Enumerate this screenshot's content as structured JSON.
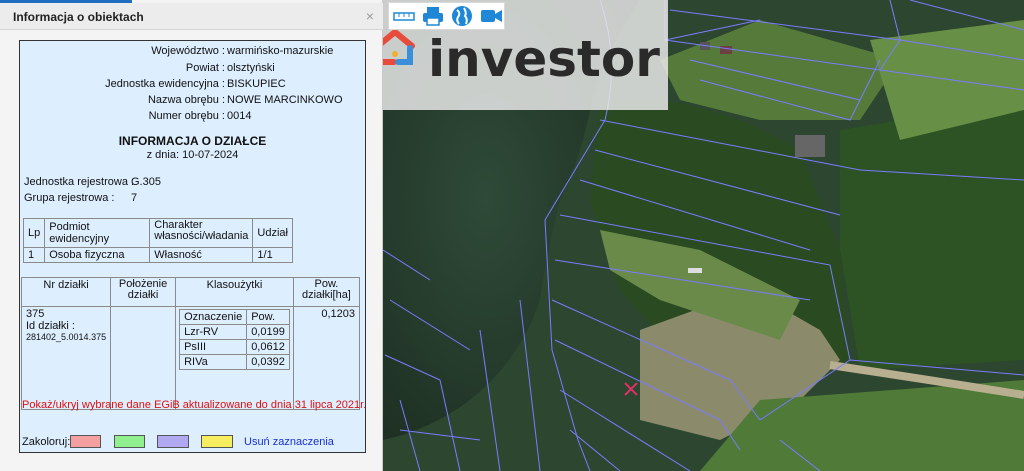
{
  "panel": {
    "title": "Informacja o obiektach",
    "close_icon": "×"
  },
  "admin": {
    "wojewodztwo_label": "Województwo :",
    "wojewodztwo_value": "warmińsko-mazurskie",
    "powiat_label": "Powiat :",
    "powiat_value": "olsztyński",
    "jednostka_label": "Jednostka ewidencyjna :",
    "jednostka_value": "BISKUPIEC",
    "obreb_label": "Nazwa obrębu :",
    "obreb_value": "NOWE MARCINKOWO",
    "numer_obrebu_label": "Numer obrębu :",
    "numer_obrebu_value": "0014"
  },
  "info": {
    "heading": "INFORMACJA O DZIAŁCE",
    "date": "z dnia: 10-07-2024",
    "jr_label": "Jednostka rejestrowa :",
    "jr_value": "G.305",
    "gr_label": "Grupa rejestrowa :",
    "gr_value": "7"
  },
  "owners": {
    "headers": [
      "Lp",
      "Podmiot ewidencyjny",
      "Charakter własności/władania",
      "Udział"
    ],
    "rows": [
      [
        "1",
        "Osoba fizyczna",
        "Własność",
        "1/1"
      ]
    ]
  },
  "parcel": {
    "headers": [
      "Nr działki",
      "Położenie działki",
      "Klasoużytki",
      "Pow. działki[ha]"
    ],
    "nr": "375",
    "id_label": "Id działki :",
    "id_value": "281402_5.0014.375",
    "area": "0,1203",
    "klas_headers": [
      "Oznaczenie",
      "Pow."
    ],
    "klasouzytki": [
      [
        "Lzr-RV",
        "0,0199"
      ],
      [
        "PsIII",
        "0,0612"
      ],
      [
        "RIVa",
        "0,0392"
      ]
    ]
  },
  "toggle_text": "Pokaż/ukryj wybrane dane EGiB aktualizowane do dnia 31 lipca 2021r.",
  "colorize": {
    "label": "Zakoloruj:",
    "swatches": [
      "#f4a0a0",
      "#90f090",
      "#b0a8f0",
      "#f6ee60"
    ],
    "clear_label": "Usuń zaznaczenia"
  },
  "toolbar": {
    "icons": [
      "measure-ruler-icon",
      "print-icon",
      "globe-icon",
      "video-camera-icon"
    ],
    "color": "#1e88d6"
  },
  "watermark": {
    "text": "investor"
  }
}
